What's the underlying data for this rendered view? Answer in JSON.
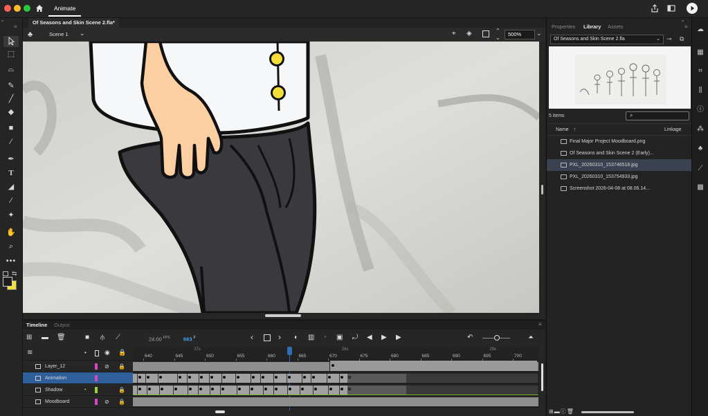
{
  "app": {
    "tab_label": "Animate"
  },
  "document": {
    "tab_title": "Of Seasons and Skin Scene 2.fla*",
    "scene_label": "Scene 1",
    "zoom": "500%"
  },
  "timeline": {
    "tab_timeline": "Timeline",
    "tab_output": "Output",
    "fps_value": "24.00",
    "fps_unit": "FPS",
    "frame_value": "663",
    "frame_unit": "F",
    "seconds_markers": [
      "27s",
      "28s",
      "29s"
    ],
    "frame_ticks": [
      "640",
      "645",
      "650",
      "655",
      "660",
      "665",
      "670",
      "675",
      "680",
      "685",
      "690",
      "695",
      "700"
    ],
    "layers": [
      {
        "name": "Layer_12",
        "selected": false
      },
      {
        "name": "Animation",
        "selected": true
      },
      {
        "name": "Shadow",
        "selected": false
      },
      {
        "name": "Moodboard",
        "selected": false
      }
    ]
  },
  "library": {
    "tabs": [
      "Properties",
      "Library",
      "Assets"
    ],
    "active_tab": "Library",
    "document_select": "Of Seasons and Skin Scene 2.fla",
    "item_count": "5 items",
    "col_name": "Name",
    "col_linkage": "Linkage",
    "items": [
      {
        "name": "Final Major Project Moodboard.png",
        "icon": "image-icon",
        "selected": false
      },
      {
        "name": "Of Seasons and Skin Scene 2 (Early)...",
        "icon": "movie-icon",
        "selected": false
      },
      {
        "name": "PXL_20260310_153746518.jpg",
        "icon": "image-icon",
        "selected": true
      },
      {
        "name": "PXL_20260310_153754933.jpg",
        "icon": "image-icon",
        "selected": false
      },
      {
        "name": "Screenshot 2026-04-08 at 08.06.14...",
        "icon": "image-icon",
        "selected": false
      }
    ]
  },
  "colors": {
    "accent": "#2f6db5",
    "keyframe_bar": "#9a9a9a",
    "button_yellow": "#f3de3a"
  }
}
